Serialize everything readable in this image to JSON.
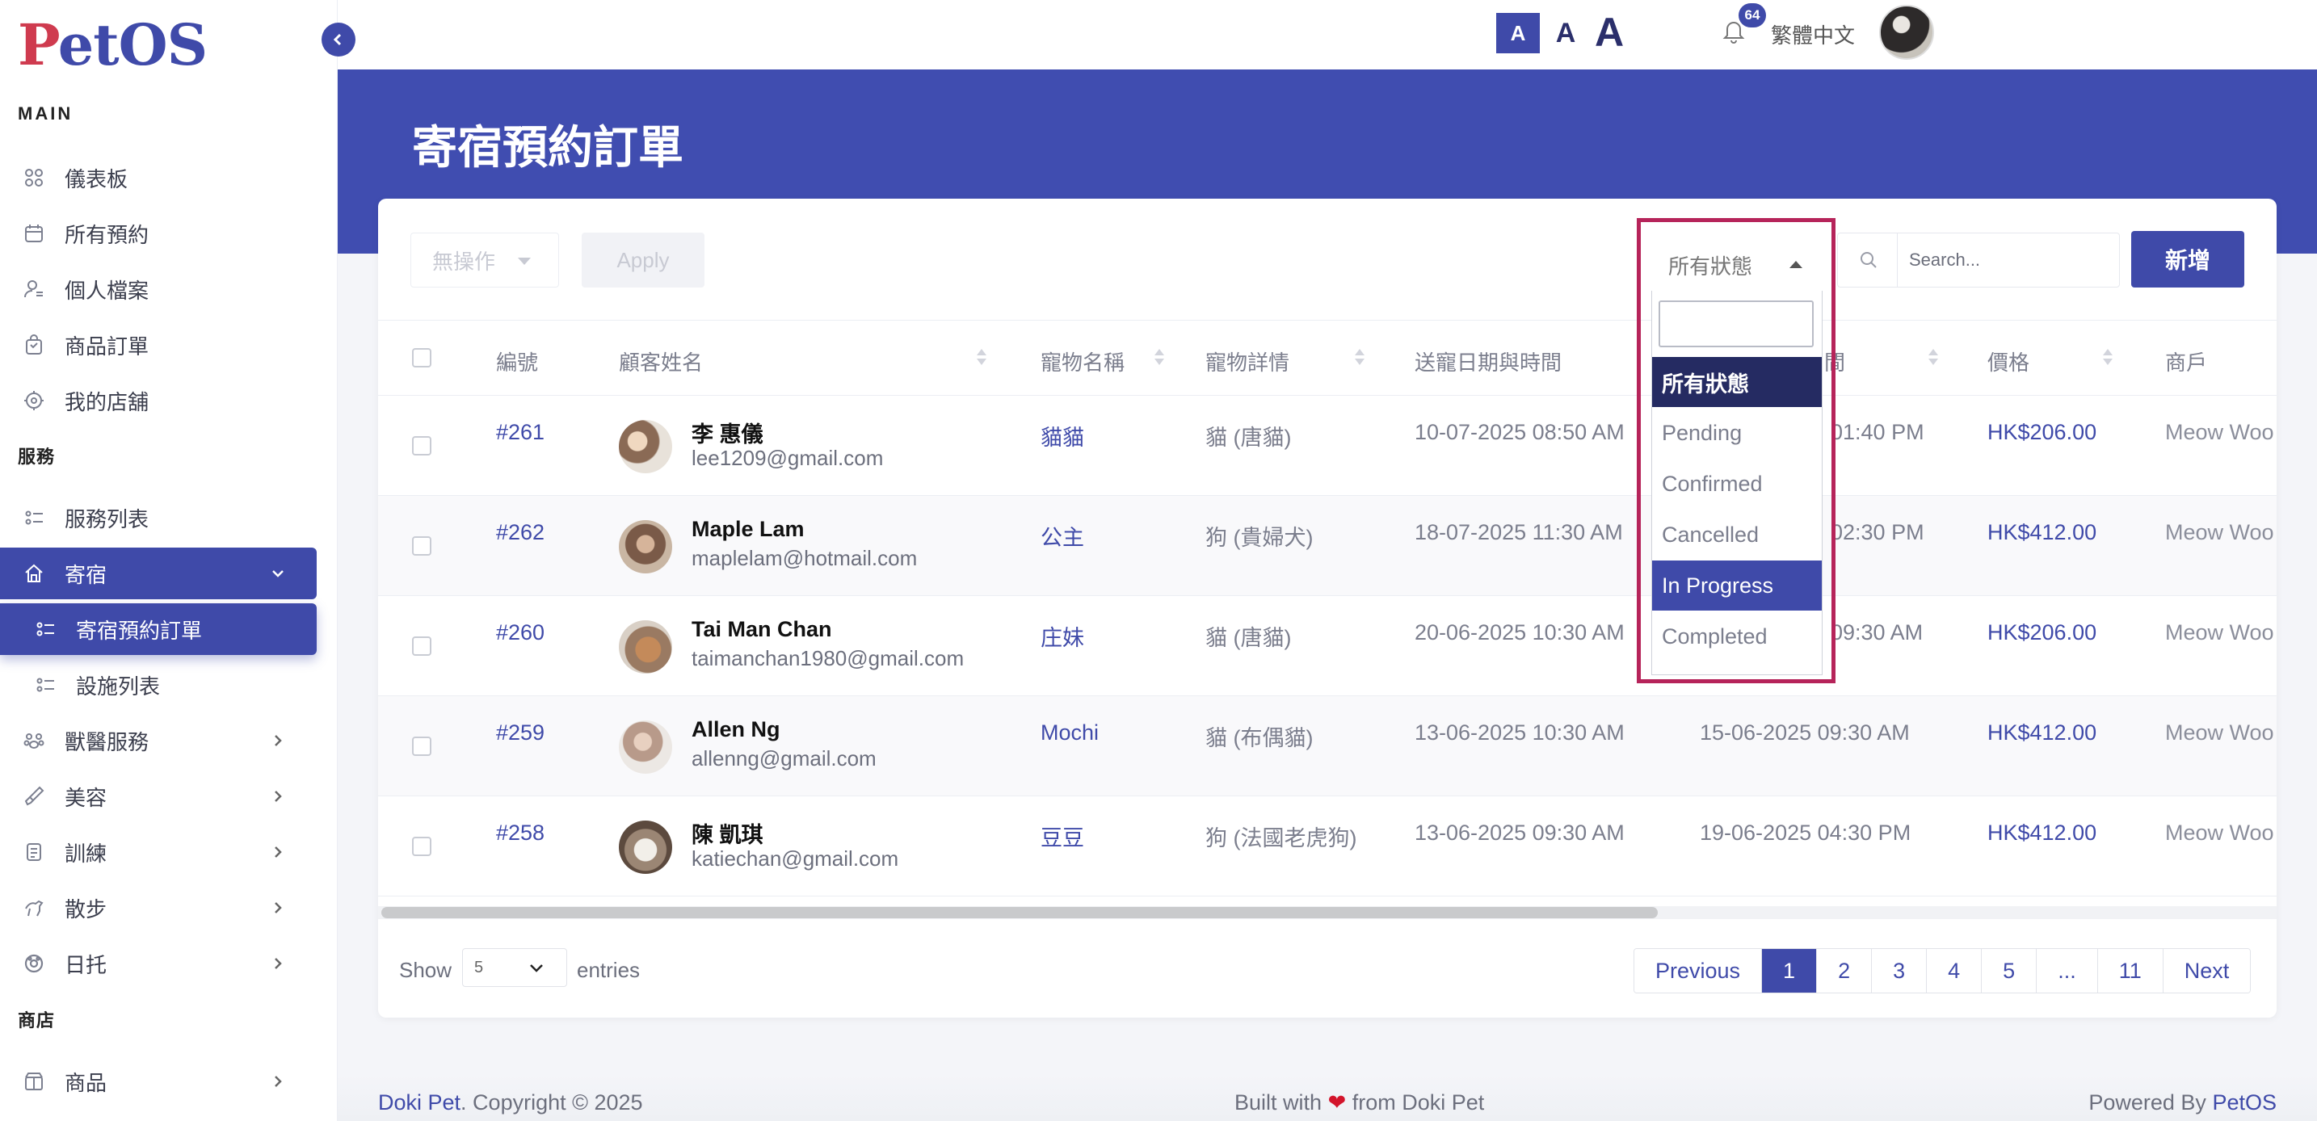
{
  "brand": {
    "logo_p": "P",
    "logo_rest": "etOS"
  },
  "topbar": {
    "font_small": "A",
    "font_mid": "A",
    "font_big": "A",
    "notif_count": "64",
    "language": "繁體中文"
  },
  "sidebar": {
    "sections": {
      "main": "MAIN",
      "service": "服務",
      "shop": "商店"
    },
    "items": [
      {
        "label": "儀表板",
        "icon": "grid-icon"
      },
      {
        "label": "所有預約",
        "icon": "calendar-icon"
      },
      {
        "label": "個人檔案",
        "icon": "user-icon"
      },
      {
        "label": "商品訂單",
        "icon": "bag-icon"
      },
      {
        "label": "我的店舖",
        "icon": "store-icon"
      },
      {
        "label": "服務列表",
        "icon": "list-icon"
      },
      {
        "label": "寄宿",
        "icon": "home-icon"
      },
      {
        "label": "寄宿預約訂單",
        "icon": "list-icon"
      },
      {
        "label": "設施列表",
        "icon": "list-icon"
      },
      {
        "label": "獸醫服務",
        "icon": "vet-icon"
      },
      {
        "label": "美容",
        "icon": "brush-icon"
      },
      {
        "label": "訓練",
        "icon": "training-icon"
      },
      {
        "label": "散步",
        "icon": "walk-icon"
      },
      {
        "label": "日托",
        "icon": "daycare-icon"
      },
      {
        "label": "商品",
        "icon": "product-icon"
      }
    ]
  },
  "page": {
    "title": "寄宿預約訂單"
  },
  "toolbar": {
    "bulk_action": "無操作",
    "apply": "Apply",
    "status_value": "所有狀態",
    "search_placeholder": "Search...",
    "add": "新增"
  },
  "status_options": [
    "所有狀態",
    "Pending",
    "Confirmed",
    "Cancelled",
    "In Progress",
    "Completed"
  ],
  "table": {
    "headers": {
      "id": "編號",
      "customer": "顧客姓名",
      "pet": "寵物名稱",
      "detail": "寵物詳情",
      "dropoff": "送寵日期與時間",
      "pickup_tail": "間",
      "price": "價格",
      "shop": "商戶"
    },
    "rows": [
      {
        "id": "#261",
        "name": "李 惠儀",
        "email": "lee1209@gmail.com",
        "pet": "貓貓",
        "detail": "貓 (唐貓)",
        "dropoff": "10-07-2025 08:50 AM",
        "pickup": "01:40 PM",
        "price": "HK$206.00",
        "shop": "Meow Woo"
      },
      {
        "id": "#262",
        "name": "Maple Lam",
        "email": "maplelam@hotmail.com",
        "pet": "公主",
        "detail": "狗 (貴婦犬)",
        "dropoff": "18-07-2025 11:30 AM",
        "pickup": "02:30 PM",
        "price": "HK$412.00",
        "shop": "Meow Woo"
      },
      {
        "id": "#260",
        "name": "Tai Man Chan",
        "email": "taimanchan1980@gmail.com",
        "pet": "庄妹",
        "detail": "貓 (唐貓)",
        "dropoff": "20-06-2025 10:30 AM",
        "pickup": "09:30 AM",
        "price": "HK$206.00",
        "shop": "Meow Woo"
      },
      {
        "id": "#259",
        "name": "Allen Ng",
        "email": "allenng@gmail.com",
        "pet": "Mochi",
        "detail": "貓 (布偶貓)",
        "dropoff": "13-06-2025 10:30 AM",
        "pickup": "15-06-2025 09:30 AM",
        "price": "HK$412.00",
        "shop": "Meow Woo"
      },
      {
        "id": "#258",
        "name": "陳 凱琪",
        "email": "katiechan@gmail.com",
        "pet": "豆豆",
        "detail": "狗 (法國老虎狗)",
        "dropoff": "13-06-2025 09:30 AM",
        "pickup": "19-06-2025 04:30 PM",
        "price": "HK$412.00",
        "shop": "Meow Woo"
      }
    ]
  },
  "footer_controls": {
    "show": "Show",
    "length": "5",
    "entries": "entries",
    "pages": [
      "Previous",
      "1",
      "2",
      "3",
      "4",
      "5",
      "...",
      "11",
      "Next"
    ],
    "current_page": "1"
  },
  "footer": {
    "brand": "Doki Pet",
    "copyright": ". Copyright © 2025",
    "built_pre": "Built with",
    "built_post": "from Doki Pet",
    "powered_pre": "Powered By",
    "powered_brand": "PetOS"
  },
  "colors": {
    "primary": "#3f4aa9",
    "highlight_border": "#b6245a",
    "selected_option": "#252b62"
  }
}
